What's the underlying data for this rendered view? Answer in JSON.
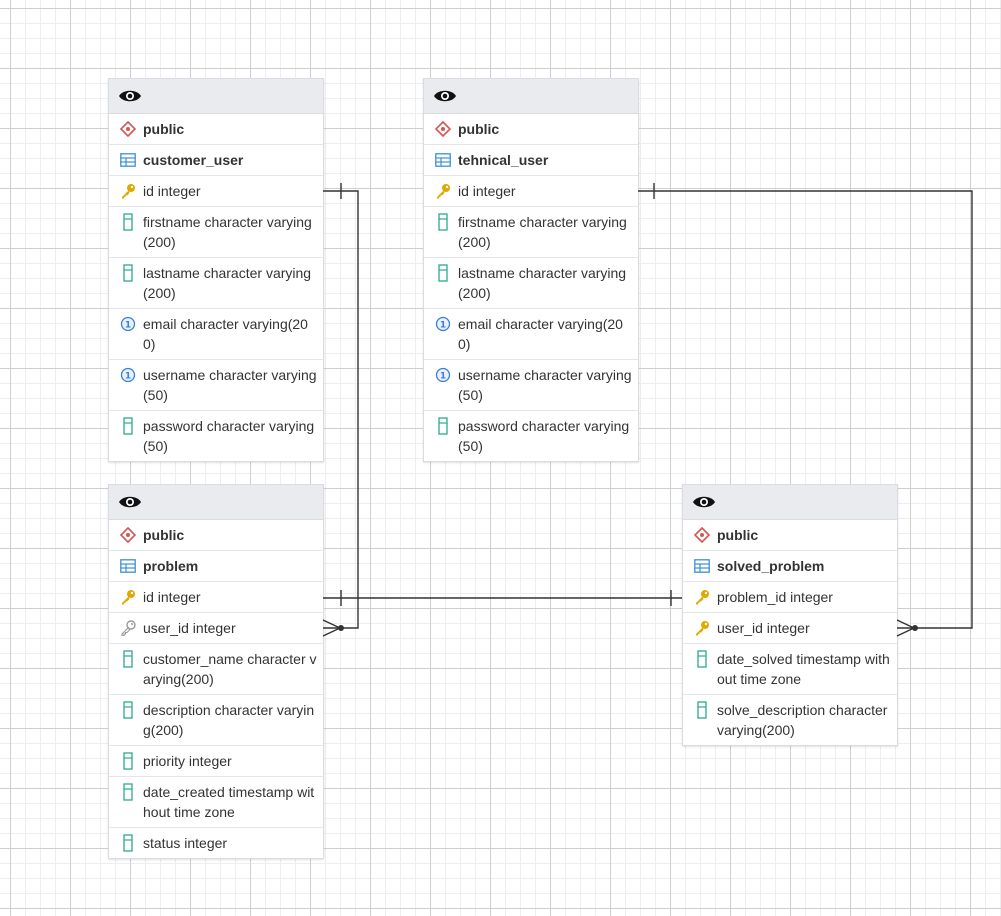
{
  "tables": [
    {
      "schema": "public",
      "name": "customer_user",
      "columns": [
        {
          "label": "id integer",
          "kind": "primary-key-icon"
        },
        {
          "label": "firstname character varying(200)",
          "kind": "column-icon"
        },
        {
          "label": "lastname character varying(200)",
          "kind": "column-icon"
        },
        {
          "label": "email character varying(200)",
          "kind": "unique-icon"
        },
        {
          "label": "username character varying(50)",
          "kind": "unique-icon"
        },
        {
          "label": "password character varying(50)",
          "kind": "column-icon"
        }
      ]
    },
    {
      "schema": "public",
      "name": "tehnical_user",
      "columns": [
        {
          "label": "id integer",
          "kind": "primary-key-icon"
        },
        {
          "label": "firstname character varying(200)",
          "kind": "column-icon"
        },
        {
          "label": "lastname character varying(200)",
          "kind": "column-icon"
        },
        {
          "label": "email character varying(200)",
          "kind": "unique-icon"
        },
        {
          "label": "username character varying(50)",
          "kind": "unique-icon"
        },
        {
          "label": "password character varying(50)",
          "kind": "column-icon"
        }
      ]
    },
    {
      "schema": "public",
      "name": "problem",
      "columns": [
        {
          "label": "id integer",
          "kind": "primary-key-icon"
        },
        {
          "label": "user_id integer",
          "kind": "foreign-key-icon"
        },
        {
          "label": "customer_name character varying(200)",
          "kind": "column-icon"
        },
        {
          "label": "description character varying(200)",
          "kind": "column-icon"
        },
        {
          "label": "priority integer",
          "kind": "column-icon"
        },
        {
          "label": "date_created timestamp without time zone",
          "kind": "column-icon"
        },
        {
          "label": "status integer",
          "kind": "column-icon"
        }
      ]
    },
    {
      "schema": "public",
      "name": "solved_problem",
      "columns": [
        {
          "label": "problem_id integer",
          "kind": "primary-key-icon"
        },
        {
          "label": "user_id integer",
          "kind": "primary-key-icon"
        },
        {
          "label": "date_solved timestamp without time zone",
          "kind": "column-icon"
        },
        {
          "label": "solve_description character varying(200)",
          "kind": "column-icon"
        }
      ]
    }
  ],
  "relations": [
    {
      "from_table": "customer_user",
      "from_column": "id integer",
      "to_table": "problem",
      "to_column": "user_id integer"
    },
    {
      "from_table": "problem",
      "from_column": "id integer",
      "to_table": "solved_problem",
      "to_column": "problem_id integer"
    },
    {
      "from_table": "tehnical_user",
      "from_column": "id integer",
      "to_table": "solved_problem",
      "to_column": "user_id integer"
    }
  ],
  "colors": {
    "key": "#e0a800",
    "column": "#2bab8f",
    "unique": "#3b7fd8",
    "schema": "#d9534f",
    "table": "#3b8fd8",
    "line": "#333333"
  }
}
